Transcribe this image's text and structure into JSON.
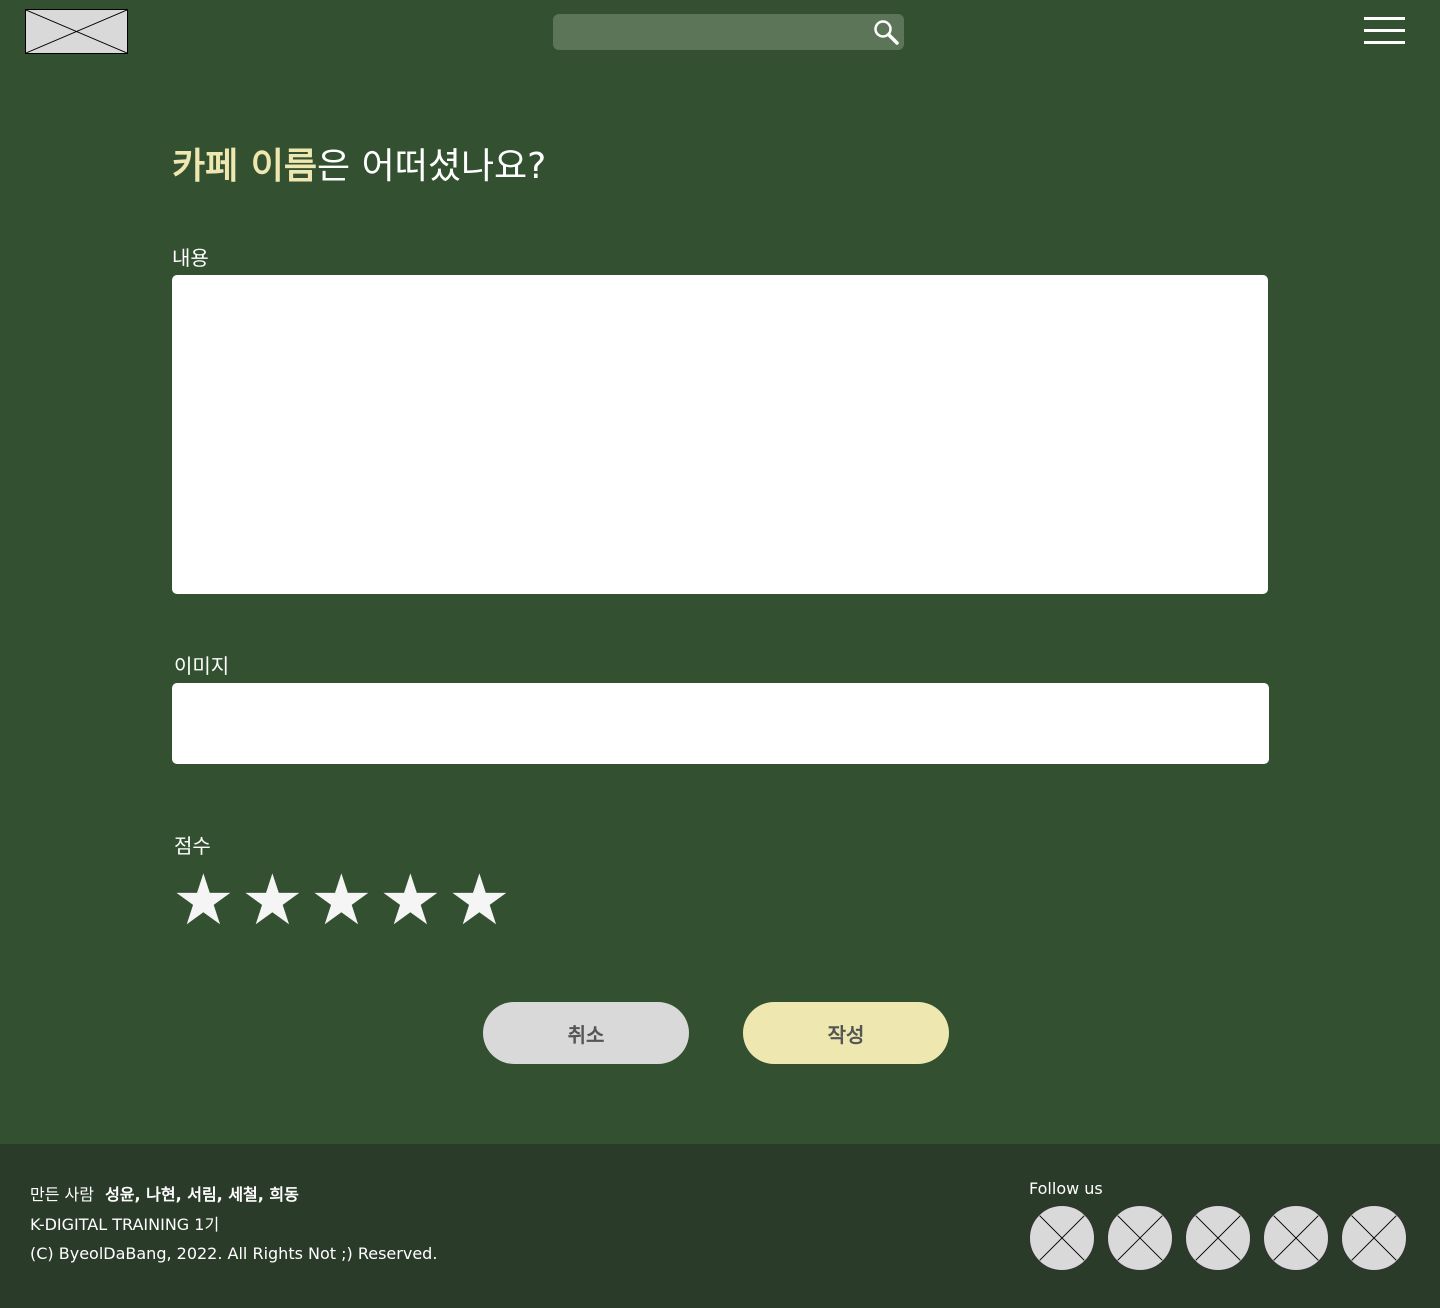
{
  "header": {
    "logo": "logo-placeholder-icon",
    "search": {
      "value": "",
      "placeholder": ""
    },
    "search_icon": "magnifier-icon",
    "menu_icon": "hamburger-menu-icon"
  },
  "title": {
    "cafe_name": "카페 이름",
    "rest": "은 어떠셨나요?"
  },
  "form": {
    "content_label": "내용",
    "content_value": "",
    "image_label": "이미지",
    "image_value": "",
    "score_label": "점수",
    "stars": [
      "★",
      "★",
      "★",
      "★",
      "★"
    ],
    "rating": 5
  },
  "buttons": {
    "cancel": "취소",
    "submit": "작성"
  },
  "footer": {
    "makers_label": "만든 사람",
    "makers_names": "성윤, 나현, 서림, 세철, 희동",
    "program": "K-DIGITAL TRAINING 1기",
    "copyright": "(C) ByeolDaBang, 2022. All Rights Not ;) Reserved.",
    "follow_label": "Follow us",
    "social_icons": [
      "social-placeholder-icon",
      "social-placeholder-icon",
      "social-placeholder-icon",
      "social-placeholder-icon",
      "social-placeholder-icon"
    ]
  },
  "colors": {
    "background": "#335131",
    "footer": "#2b3b2a",
    "accent": "#eee8b0",
    "cancel": "#d9d9d9",
    "search": "#5c7559"
  }
}
